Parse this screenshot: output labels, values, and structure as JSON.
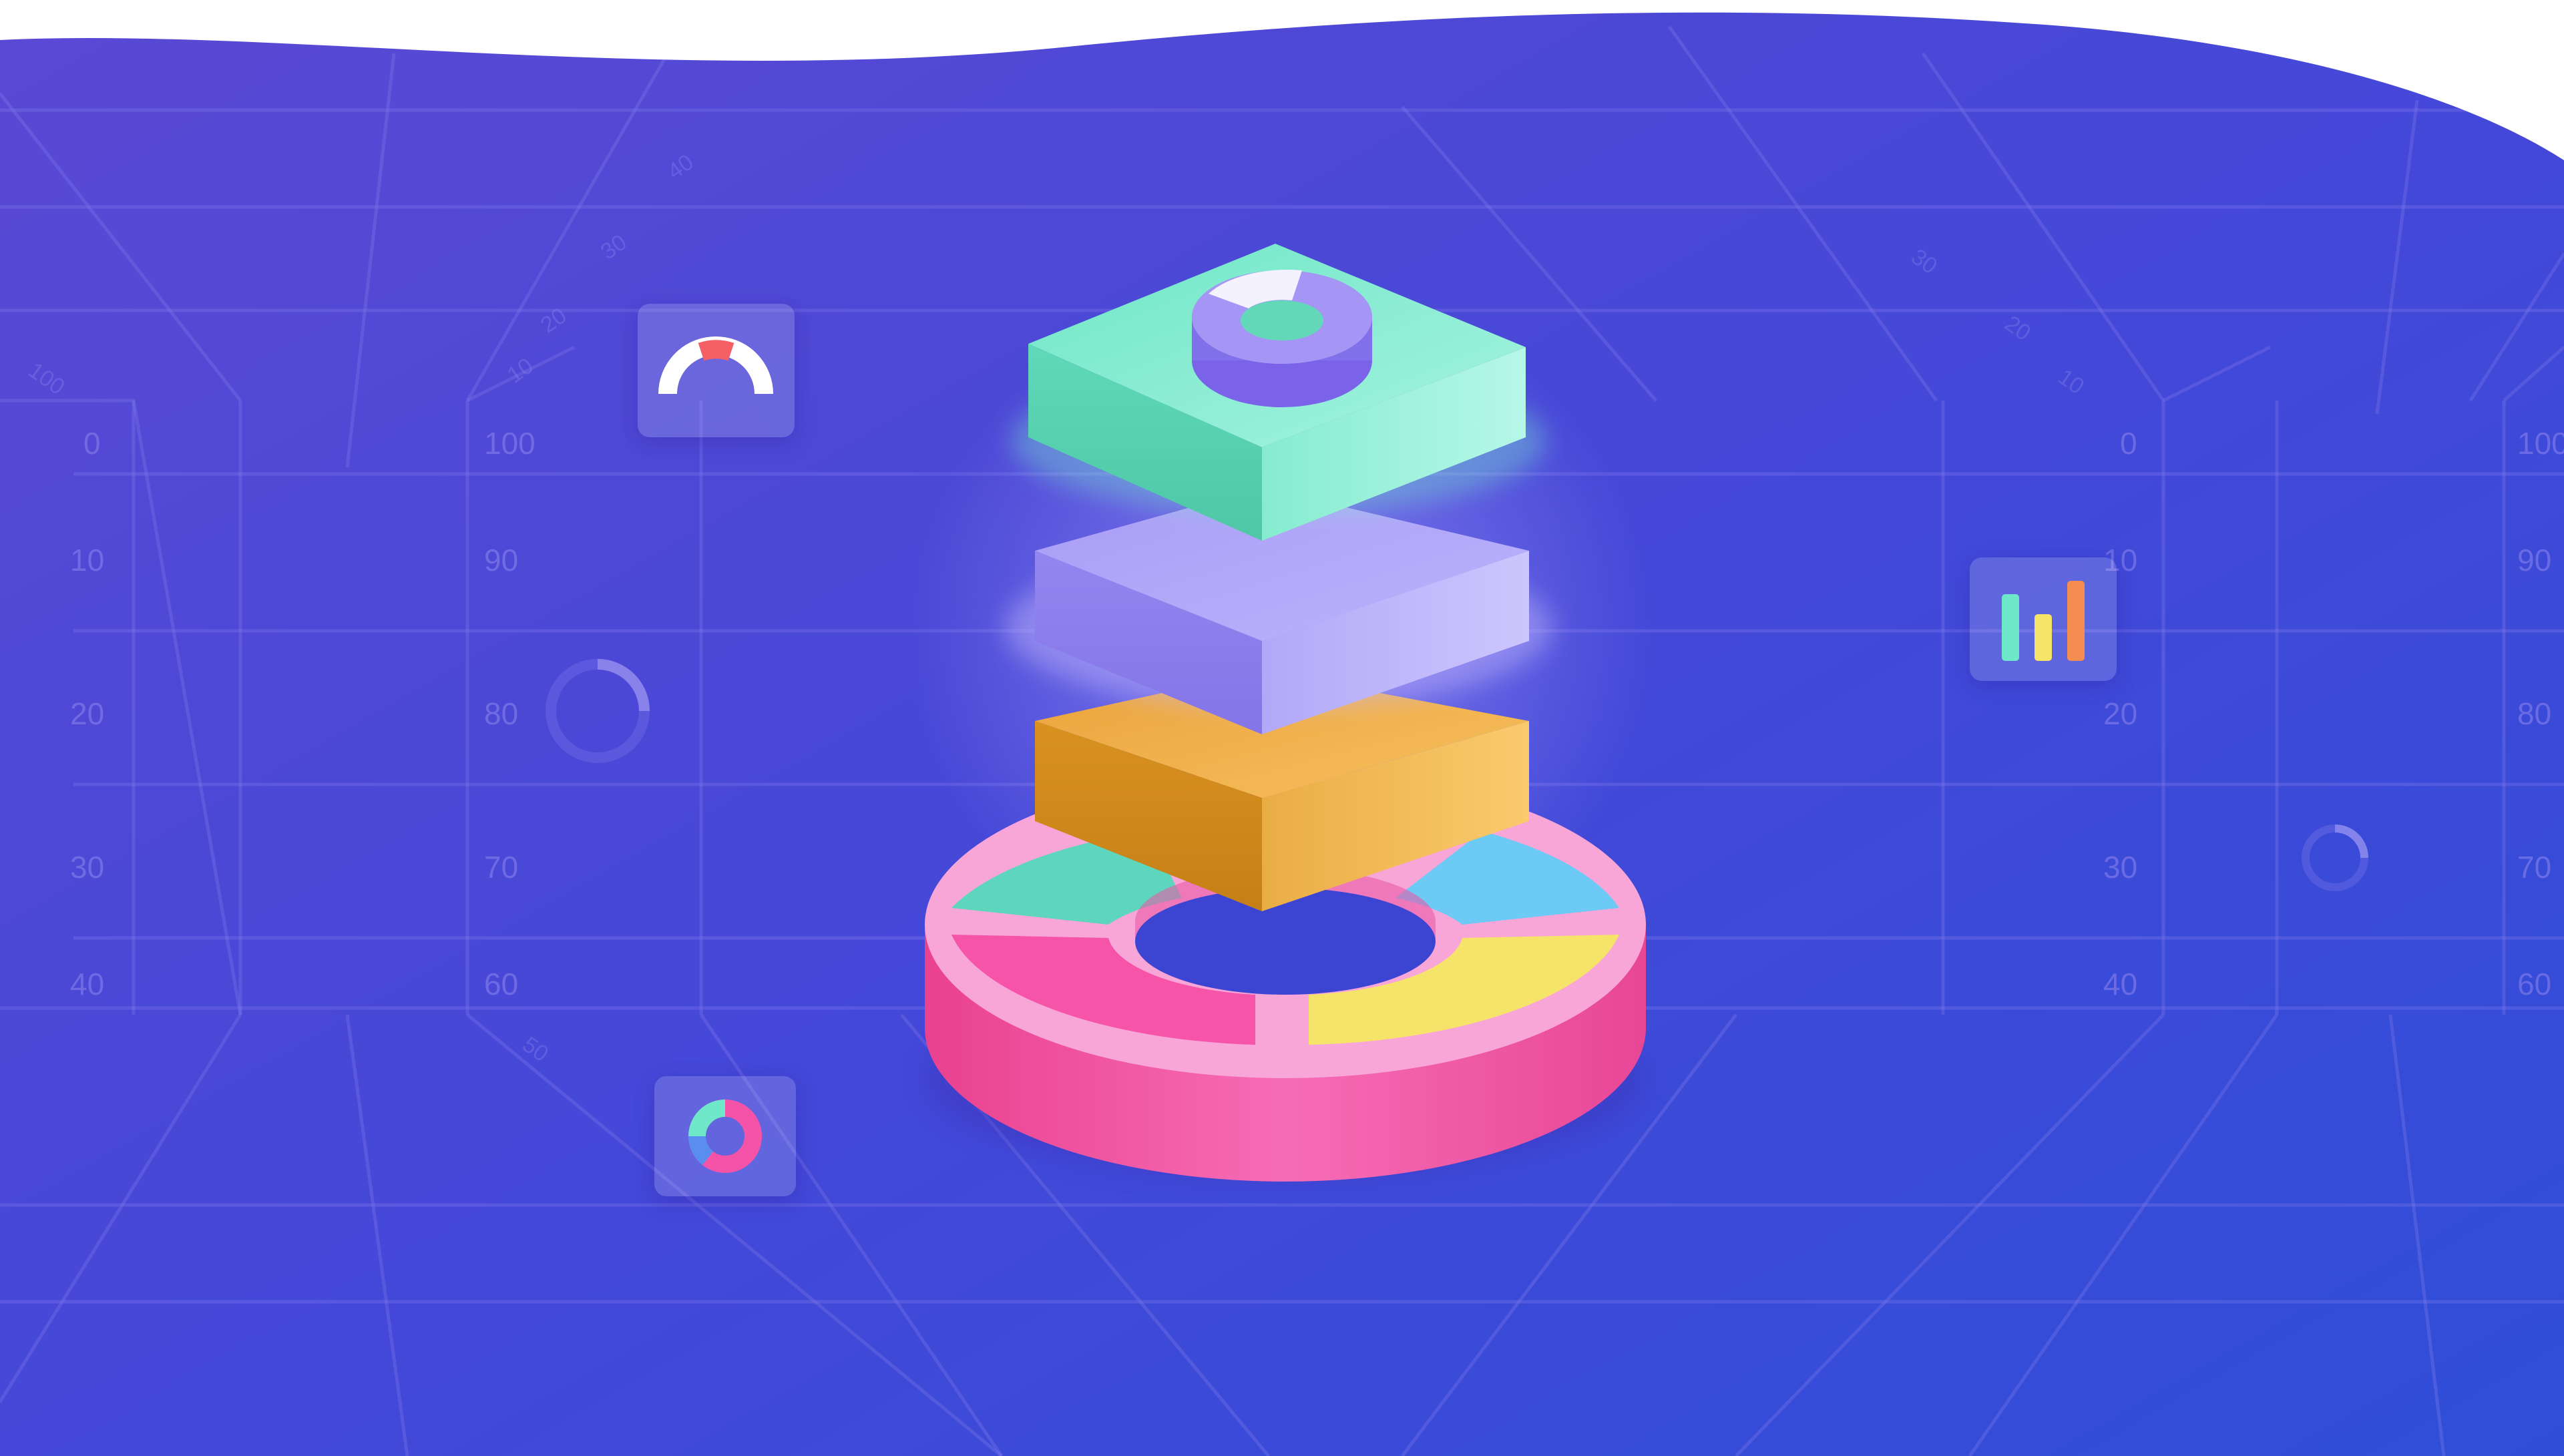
{
  "illustration": {
    "colors": {
      "bg_start": "#5b4bd6",
      "bg_end": "#2f4fd8",
      "grid": "#7d76e8",
      "teal": "#6ee8c9",
      "lavender": "#a79cf5",
      "amber": "#f0a83a",
      "pink": "#f553a7",
      "yellow": "#f6e46a",
      "sky": "#66c8f5",
      "red": "#f55f66"
    },
    "left_scale_labels": [
      "0",
      "10",
      "20",
      "30",
      "40"
    ],
    "left_inner_scale_labels": [
      "100",
      "90",
      "80",
      "70",
      "60"
    ],
    "right_scale_labels": [
      "0",
      "10",
      "20",
      "30",
      "40"
    ],
    "right_edge_scale_labels": [
      "100",
      "90",
      "80",
      "70",
      "60"
    ],
    "diagonal_labels": [
      "40",
      "30",
      "20",
      "10",
      "100",
      "50",
      "30",
      "20",
      "10"
    ],
    "icons": {
      "gauge": "gauge-icon",
      "bar_chart": "bar-chart-icon",
      "donut": "donut-icon",
      "ring_left": "ring-progress-icon",
      "ring_right": "ring-progress-icon"
    }
  }
}
